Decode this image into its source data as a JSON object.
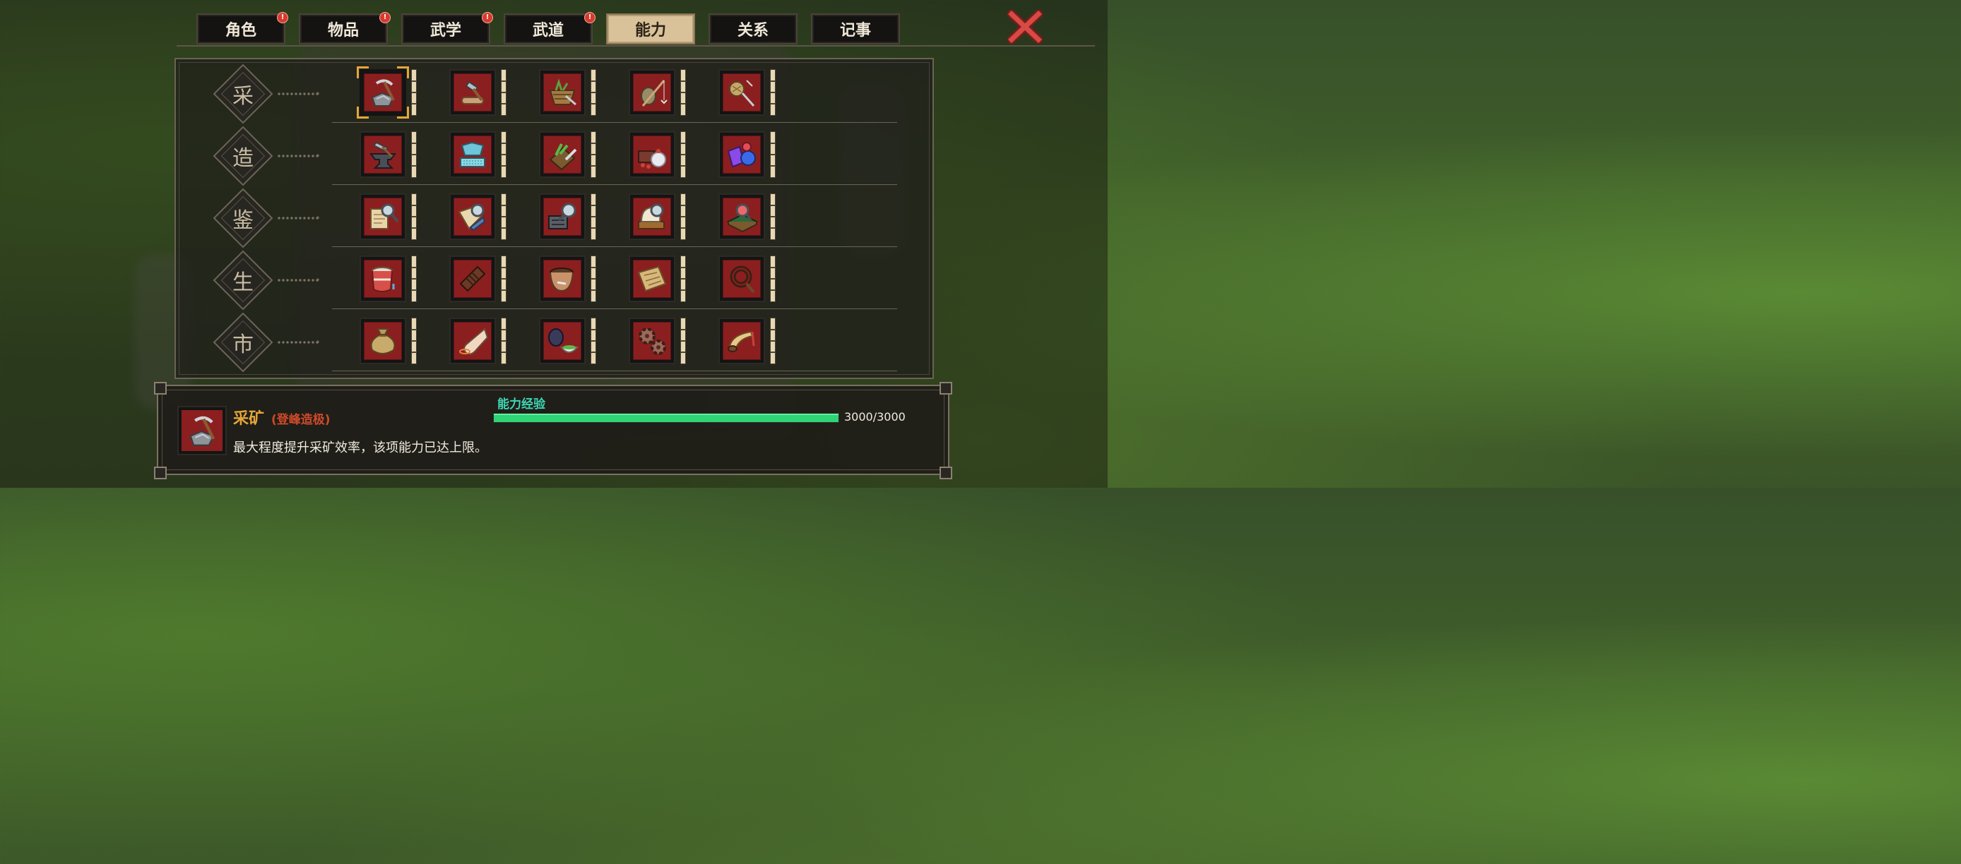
{
  "tabs": [
    {
      "label": "角色",
      "badge": "!",
      "active": false
    },
    {
      "label": "物品",
      "badge": "!",
      "active": false
    },
    {
      "label": "武学",
      "badge": "!",
      "active": false
    },
    {
      "label": "武道",
      "badge": "!",
      "active": false
    },
    {
      "label": "能力",
      "badge": "",
      "active": true
    },
    {
      "label": "关系",
      "badge": "",
      "active": false
    },
    {
      "label": "记事",
      "badge": "",
      "active": false
    }
  ],
  "close_icon": "close-x-icon",
  "grid": {
    "rows": [
      {
        "label": "采",
        "skills": [
          "pickaxe-ore-icon",
          "axe-log-icon",
          "herb-basket-icon",
          "fishing-rod-icon",
          "bug-net-icon"
        ]
      },
      {
        "label": "造",
        "skills": [
          "anvil-hammer-icon",
          "fabric-bolt-icon",
          "herb-knife-icon",
          "cooking-dish-icon",
          "gemstones-icon"
        ]
      },
      {
        "label": "鉴",
        "skills": [
          "scroll-magnifier-icon",
          "book-magnifier-icon",
          "furnace-magnifier-icon",
          "jade-magnifier-icon",
          "board-magnifier-icon"
        ]
      },
      {
        "label": "生",
        "skills": [
          "jar-icon",
          "chocolate-bar-icon",
          "bowl-icon",
          "map-parchment-icon",
          "whip-rope-icon"
        ]
      },
      {
        "label": "市",
        "skills": [
          "money-pouch-icon",
          "pointing-hand-icon",
          "tea-cup-icon",
          "gears-icon",
          "horn-icon"
        ]
      }
    ],
    "selected": {
      "row": 0,
      "col": 0
    }
  },
  "detail": {
    "icon": "pickaxe-ore-icon",
    "name": "采矿",
    "level": "(登峰造极)",
    "description": "最大程度提升采矿效率，该项能力已达上限。",
    "exp_label": "能力经验",
    "exp_text": "3000/3000",
    "exp_fraction": 1.0
  },
  "colors": {
    "accent_gold": "#e5a63a",
    "level_red": "#d04a2a",
    "exp_green": "#2ed476",
    "exp_label": "#3ed6b4",
    "skill_red": "#8b1f1f"
  }
}
